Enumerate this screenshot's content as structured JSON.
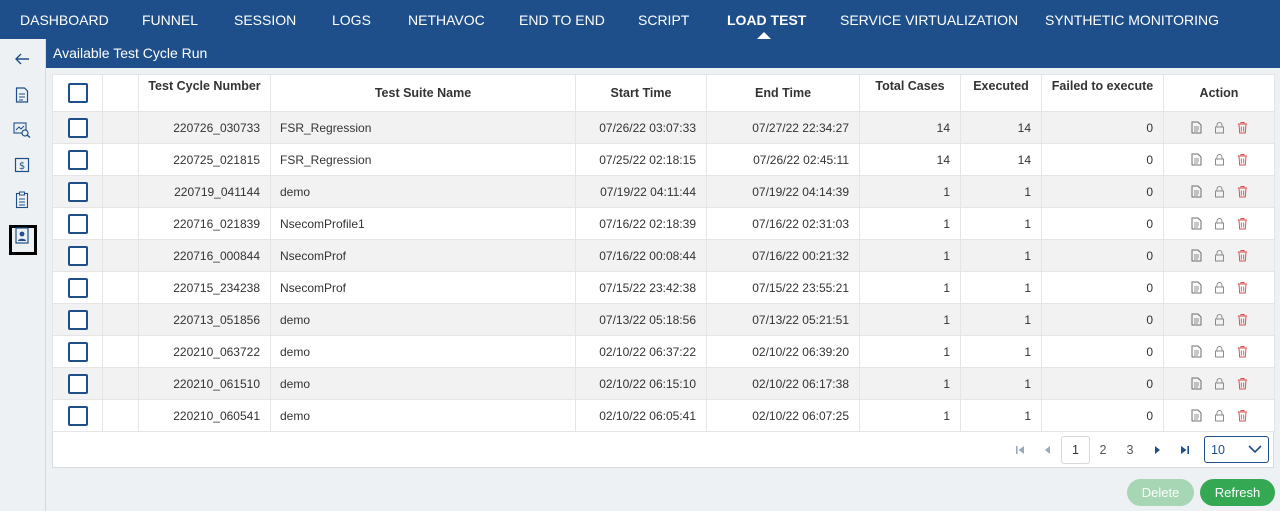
{
  "nav": {
    "items": [
      {
        "label": "DASHBOARD"
      },
      {
        "label": "FUNNEL"
      },
      {
        "label": "SESSION"
      },
      {
        "label": "LOGS"
      },
      {
        "label": "NETHAVOC"
      },
      {
        "label": "END TO END"
      },
      {
        "label": "SCRIPT"
      },
      {
        "label": "LOAD TEST"
      },
      {
        "label": "SERVICE VIRTUALIZATION"
      },
      {
        "label": "SYNTHETIC MONITORING"
      }
    ],
    "active": "LOAD TEST"
  },
  "sidebar": {
    "icons": [
      "back-arrow-icon",
      "document-icon",
      "search-chart-icon",
      "dollar-doc-icon",
      "clipboard-list-icon",
      "user-profile-icon"
    ],
    "selected": "clipboard-list-icon"
  },
  "page": {
    "title": "Available Test Cycle Run"
  },
  "table": {
    "headers": {
      "cycle": "Test Cycle Number",
      "suite": "Test Suite Name",
      "start": "Start Time",
      "end": "End Time",
      "total": "Total Cases",
      "executed": "Executed",
      "failed": "Failed to execute",
      "action": "Action"
    },
    "rows": [
      {
        "cycle": "220726_030733",
        "suite": "FSR_Regression",
        "start": "07/26/22 03:07:33",
        "end": "07/27/22 22:34:27",
        "total": "14",
        "executed": "14",
        "failed": "0"
      },
      {
        "cycle": "220725_021815",
        "suite": "FSR_Regression",
        "start": "07/25/22 02:18:15",
        "end": "07/26/22 02:45:11",
        "total": "14",
        "executed": "14",
        "failed": "0"
      },
      {
        "cycle": "220719_041144",
        "suite": "demo",
        "start": "07/19/22 04:11:44",
        "end": "07/19/22 04:14:39",
        "total": "1",
        "executed": "1",
        "failed": "0"
      },
      {
        "cycle": "220716_021839",
        "suite": "NsecomProfile1",
        "start": "07/16/22 02:18:39",
        "end": "07/16/22 02:31:03",
        "total": "1",
        "executed": "1",
        "failed": "0"
      },
      {
        "cycle": "220716_000844",
        "suite": "NsecomProf",
        "start": "07/16/22 00:08:44",
        "end": "07/16/22 00:21:32",
        "total": "1",
        "executed": "1",
        "failed": "0"
      },
      {
        "cycle": "220715_234238",
        "suite": "NsecomProf",
        "start": "07/15/22 23:42:38",
        "end": "07/15/22 23:55:21",
        "total": "1",
        "executed": "1",
        "failed": "0"
      },
      {
        "cycle": "220713_051856",
        "suite": "demo",
        "start": "07/13/22 05:18:56",
        "end": "07/13/22 05:21:51",
        "total": "1",
        "executed": "1",
        "failed": "0"
      },
      {
        "cycle": "220210_063722",
        "suite": "demo",
        "start": "02/10/22 06:37:22",
        "end": "02/10/22 06:39:20",
        "total": "1",
        "executed": "1",
        "failed": "0"
      },
      {
        "cycle": "220210_061510",
        "suite": "demo",
        "start": "02/10/22 06:15:10",
        "end": "02/10/22 06:17:38",
        "total": "1",
        "executed": "1",
        "failed": "0"
      },
      {
        "cycle": "220210_060541",
        "suite": "demo",
        "start": "02/10/22 06:05:41",
        "end": "02/10/22 06:07:25",
        "total": "1",
        "executed": "1",
        "failed": "0"
      }
    ]
  },
  "pagination": {
    "pages": [
      "1",
      "2",
      "3"
    ],
    "current": "1",
    "page_size": "10"
  },
  "buttons": {
    "delete": "Delete",
    "refresh": "Refresh"
  },
  "colors": {
    "brand": "#1e4f8a",
    "refresh": "#34a853",
    "delete_disabled": "#a6d6b3",
    "trash": "#d9534f"
  }
}
